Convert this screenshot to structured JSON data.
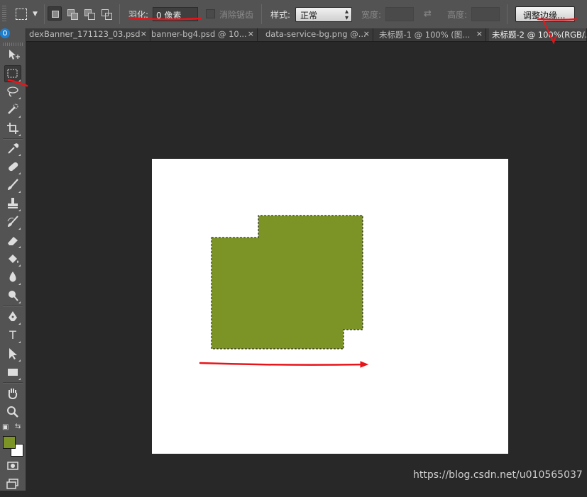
{
  "options_bar": {
    "feather_label": "羽化:",
    "feather_value": "0 像素",
    "antialias_label": "消除锯齿",
    "style_label": "样式:",
    "style_value": "正常",
    "width_label": "宽度:",
    "height_label": "高度:",
    "refine_edge_label": "调整边缘..."
  },
  "tabs": [
    {
      "label": "dexBanner_171123_03.psd",
      "close": "×"
    },
    {
      "label": "banner-bg4.psd @ 10...",
      "close": "×"
    },
    {
      "label": "data-service-bg.png @...",
      "close": "×"
    },
    {
      "label": "未标题-1 @ 100% (图...",
      "close": "×"
    },
    {
      "label": "未标题-2 @ 100%(RGB/...",
      "close": ""
    }
  ],
  "tools": [
    "move-icon",
    "rect-marquee-icon",
    "lasso-icon",
    "quick-select-icon",
    "crop-icon",
    "eyedropper-icon",
    "healing-brush-icon",
    "brush-icon",
    "clone-stamp-icon",
    "history-brush-icon",
    "eraser-icon",
    "paint-bucket-icon",
    "blur-icon",
    "dodge-icon",
    "pen-icon",
    "type-icon",
    "path-select-icon",
    "rectangle-shape-icon",
    "hand-icon",
    "zoom-icon"
  ],
  "colors": {
    "foreground": "#7c9425",
    "background": "#ffffff",
    "selection_fill": "#7c9425",
    "annotation": "#e8141a"
  },
  "watermark": "https://blog.csdn.net/u010565037"
}
